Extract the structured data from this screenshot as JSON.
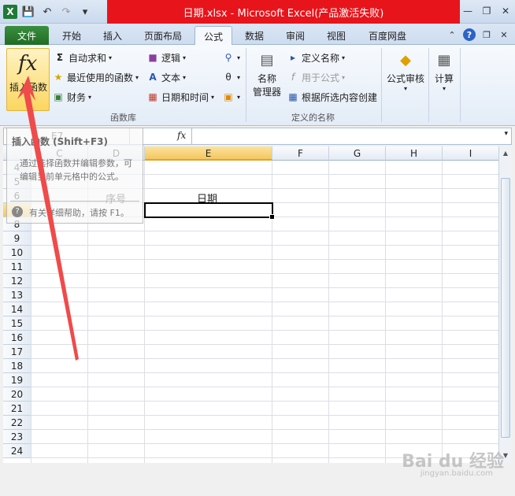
{
  "window": {
    "title": "日期.xlsx - Microsoft Excel(产品激活失败)",
    "qat_icons": [
      "excel-logo",
      "save-icon",
      "undo-icon",
      "redo-icon",
      "customize-icon"
    ]
  },
  "tabs": [
    "文件",
    "开始",
    "插入",
    "页面布局",
    "公式",
    "数据",
    "审阅",
    "视图",
    "百度网盘"
  ],
  "active_tab": "公式",
  "ribbon": {
    "insert_function": {
      "symbol": "fx",
      "label": "插入函数"
    },
    "function_library": {
      "items": [
        "自动求和",
        "最近使用的函数",
        "财务",
        "逻辑",
        "文本",
        "日期和时间"
      ],
      "group_label": "函数库"
    },
    "defined_names": {
      "name_manager": "名称\n管理器",
      "name_manager_line1": "名称",
      "name_manager_line2": "管理器",
      "define_name": "定义名称",
      "use_in_formula": "用于公式",
      "create_from_selection": "根据所选内容创建",
      "group_label": "定义的名称"
    },
    "formula_auditing": "公式审核",
    "calculation": "计算"
  },
  "formula_bar": {
    "name_box": "E7",
    "fx": "fx",
    "value": ""
  },
  "tooltip": {
    "title": "插入函数 (Shift+F3)",
    "body": "通过选择函数并编辑参数，可编辑当前单元格中的公式。",
    "help": "有关详细帮助，请按 F1。"
  },
  "sheet": {
    "columns": [
      "C",
      "D",
      "E",
      "F",
      "G",
      "H",
      "I"
    ],
    "selected_column": "E",
    "rows": [
      "4",
      "5",
      "6",
      "7",
      "8",
      "9",
      "10",
      "11",
      "12",
      "13",
      "14",
      "15",
      "16",
      "17",
      "18",
      "19",
      "20",
      "21",
      "22",
      "23",
      "24"
    ],
    "selected_row": "7",
    "cells": {
      "D6": "序号",
      "E6": "日期"
    }
  },
  "watermark": {
    "brand": "Bai du 经验",
    "url": "jingyan.baidu.com"
  },
  "colors": {
    "title_red": "#e8141b",
    "file_tab": "#1f6d24",
    "selection": "#f5c65e",
    "annotation_arrow": "#f04a4a"
  }
}
